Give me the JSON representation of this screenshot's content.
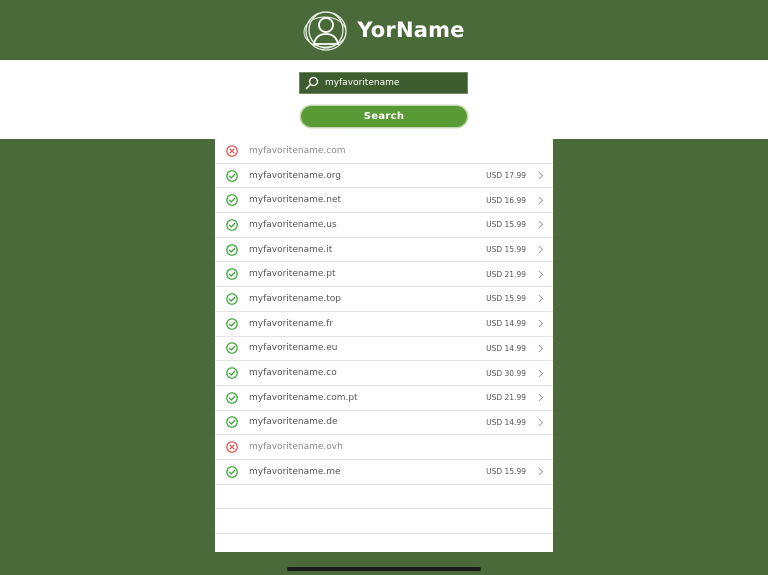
{
  "header": {
    "brand": "YorName",
    "logo_icon": "person-circle-logo-icon",
    "background": "#4a6b39"
  },
  "search": {
    "query": "myfavoritename",
    "button_label": "Search",
    "icon": "search-icon"
  },
  "results": [
    {
      "domain": "myfavoritename.com",
      "available": false,
      "price": ""
    },
    {
      "domain": "myfavoritename.org",
      "available": true,
      "price": "USD 17.99"
    },
    {
      "domain": "myfavoritename.net",
      "available": true,
      "price": "USD 16.99"
    },
    {
      "domain": "myfavoritename.us",
      "available": true,
      "price": "USD 15.99"
    },
    {
      "domain": "myfavoritename.it",
      "available": true,
      "price": "USD 15.99"
    },
    {
      "domain": "myfavoritename.pt",
      "available": true,
      "price": "USD 21.99"
    },
    {
      "domain": "myfavoritename.top",
      "available": true,
      "price": "USD 15.99"
    },
    {
      "domain": "myfavoritename.fr",
      "available": true,
      "price": "USD 14.99"
    },
    {
      "domain": "myfavoritename.eu",
      "available": true,
      "price": "USD 14.99"
    },
    {
      "domain": "myfavoritename.co",
      "available": true,
      "price": "USD 30.99"
    },
    {
      "domain": "myfavoritename.com.pt",
      "available": true,
      "price": "USD 21.99"
    },
    {
      "domain": "myfavoritename.de",
      "available": true,
      "price": "USD 14.99"
    },
    {
      "domain": "myfavoritename.ovh",
      "available": false,
      "price": ""
    },
    {
      "domain": "myfavoritename.me",
      "available": true,
      "price": "USD 15.99"
    }
  ],
  "colors": {
    "available": "#3aa13a",
    "unavailable": "#d9534f",
    "button": "#5a9a35"
  }
}
